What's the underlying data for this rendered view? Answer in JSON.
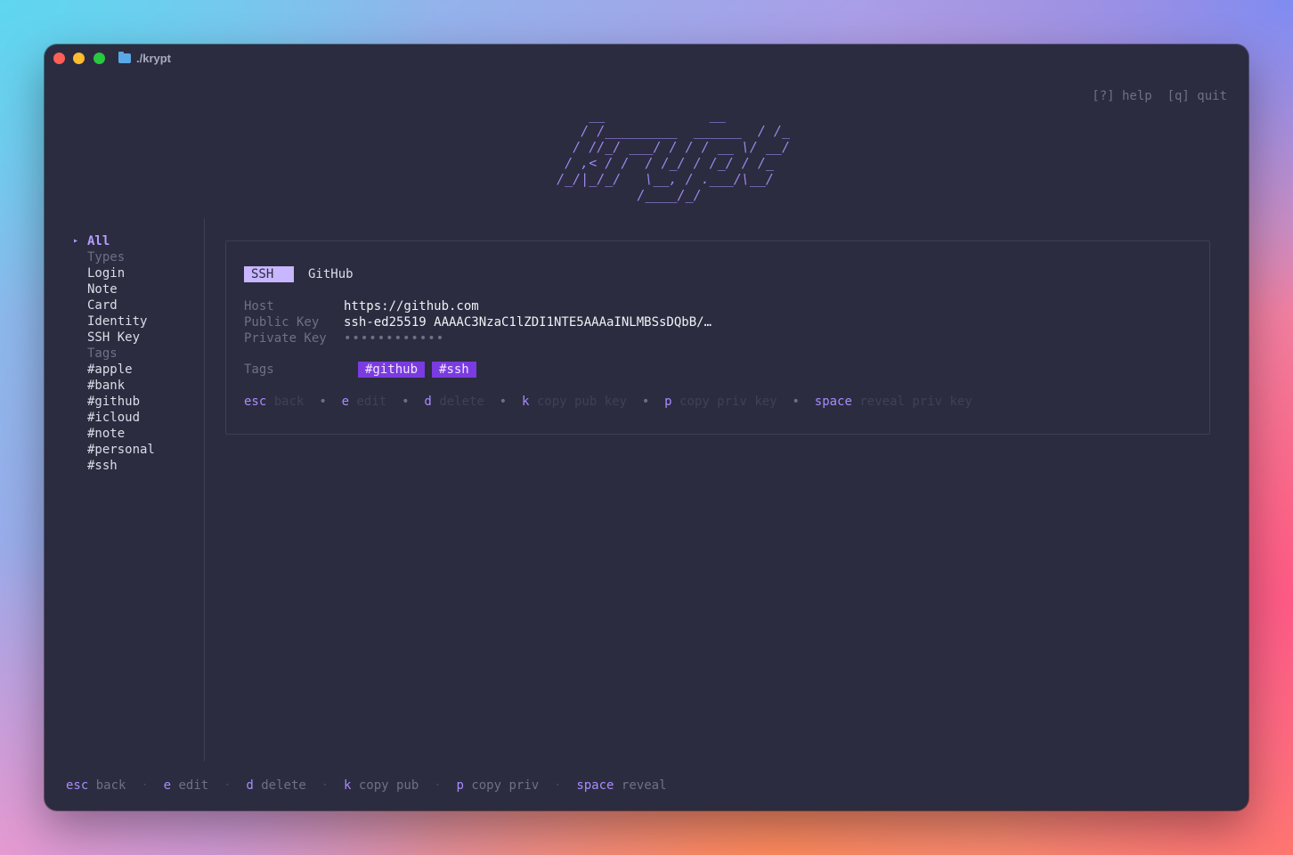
{
  "window": {
    "title": "./krypt"
  },
  "helpbar": {
    "help": "[?] help",
    "quit": "[q] quit"
  },
  "logo": {
    "ascii": "       __             __\n      / /_________  ______  / /_\n     / //_/ ___/ / / / __ \\/ __/\n    / ,< / /  / /_/ / /_/ / /_\n   /_/|_/_/   \\__, / .___/\\__/\n             /____/_/"
  },
  "sidebar": {
    "items": [
      {
        "label": "All",
        "kind": "active"
      },
      {
        "label": "Types",
        "kind": "section"
      },
      {
        "label": "Login",
        "kind": "item"
      },
      {
        "label": "Note",
        "kind": "item"
      },
      {
        "label": "Card",
        "kind": "item"
      },
      {
        "label": "Identity",
        "kind": "item"
      },
      {
        "label": "SSH Key",
        "kind": "item"
      },
      {
        "label": "Tags",
        "kind": "section"
      },
      {
        "label": "#apple",
        "kind": "item"
      },
      {
        "label": "#bank",
        "kind": "item"
      },
      {
        "label": "#github",
        "kind": "item"
      },
      {
        "label": "#icloud",
        "kind": "item"
      },
      {
        "label": "#note",
        "kind": "item"
      },
      {
        "label": "#personal",
        "kind": "item"
      },
      {
        "label": "#ssh",
        "kind": "item"
      }
    ]
  },
  "detail": {
    "type_badge": "SSH",
    "name": "GitHub",
    "fields": [
      {
        "label": "Host",
        "value": "https://github.com"
      },
      {
        "label": "Public Key",
        "value": "ssh-ed25519 AAAAC3NzaC1lZDI1NTE5AAAaINLMBSsDQbB/…"
      },
      {
        "label": "Private Key",
        "value": "••••••••••••"
      }
    ],
    "tags_label": "Tags",
    "tags": [
      "#github",
      "#ssh"
    ],
    "hints": {
      "esc": "esc",
      "esc_desc": "back",
      "e": "e",
      "e_desc": "edit",
      "d": "d",
      "d_desc": "delete",
      "k": "k",
      "k_desc": "copy pub key",
      "p": "p",
      "p_desc": "copy priv key",
      "space": "space",
      "space_desc": "reveal priv key",
      "sep": "•"
    }
  },
  "bottombar": {
    "esc": "esc",
    "esc_desc": "back",
    "e": "e",
    "e_desc": "edit",
    "d": "d",
    "d_desc": "delete",
    "k": "k",
    "k_desc": "copy pub",
    "p": "p",
    "p_desc": "copy priv",
    "space": "space",
    "space_desc": "reveal",
    "sep": "·"
  },
  "colors": {
    "accent": "#b69cff",
    "tag_bg": "#7a3be0",
    "badge_bg": "#c8b6ff",
    "window_bg": "#2b2c3f"
  }
}
